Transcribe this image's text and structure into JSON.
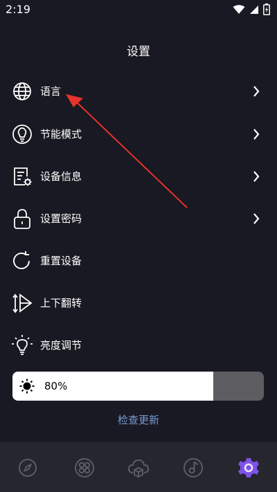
{
  "status": {
    "time": "2:19"
  },
  "page": {
    "title": "设置"
  },
  "menu": [
    {
      "label": "语言",
      "icon": "globe-icon"
    },
    {
      "label": "节能模式",
      "icon": "bulb-icon"
    },
    {
      "label": "设备信息",
      "icon": "device-info-icon"
    },
    {
      "label": "设置密码",
      "icon": "lock-icon"
    },
    {
      "label": "重置设备",
      "icon": "refresh-icon"
    },
    {
      "label": "上下翻转",
      "icon": "flip-icon"
    },
    {
      "label": "亮度调节",
      "icon": "brightness-bulb-icon"
    }
  ],
  "brightness": {
    "value_label": "80%",
    "level": 0.8
  },
  "update": {
    "label": "检查更新"
  },
  "nav": [
    {
      "icon": "compass-icon"
    },
    {
      "icon": "grid-icon"
    },
    {
      "icon": "cloud-box-icon"
    },
    {
      "icon": "music-icon"
    },
    {
      "icon": "settings-gear-icon"
    }
  ],
  "colors": {
    "background": "#181922",
    "nav_background": "#25262e",
    "accent": "#7f52e6",
    "link": "#7e9ad4",
    "annotation_arrow": "#e8322c"
  }
}
